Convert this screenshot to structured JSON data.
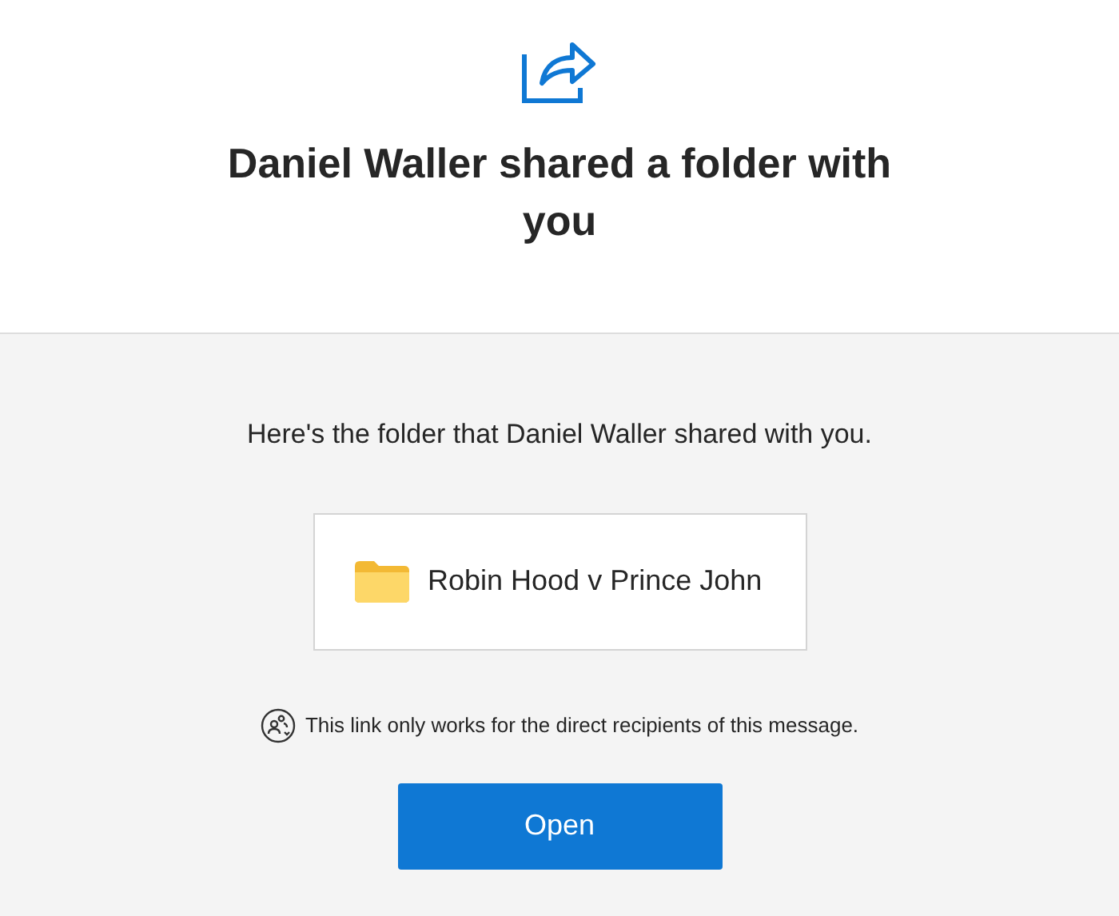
{
  "header": {
    "title": "Daniel Waller shared a folder with you"
  },
  "body": {
    "message": "Here's the folder that Daniel Waller shared with you.",
    "folder": {
      "name": "Robin Hood v Prince John"
    },
    "notice": "This link only works for the direct recipients of this message.",
    "button": "Open"
  }
}
